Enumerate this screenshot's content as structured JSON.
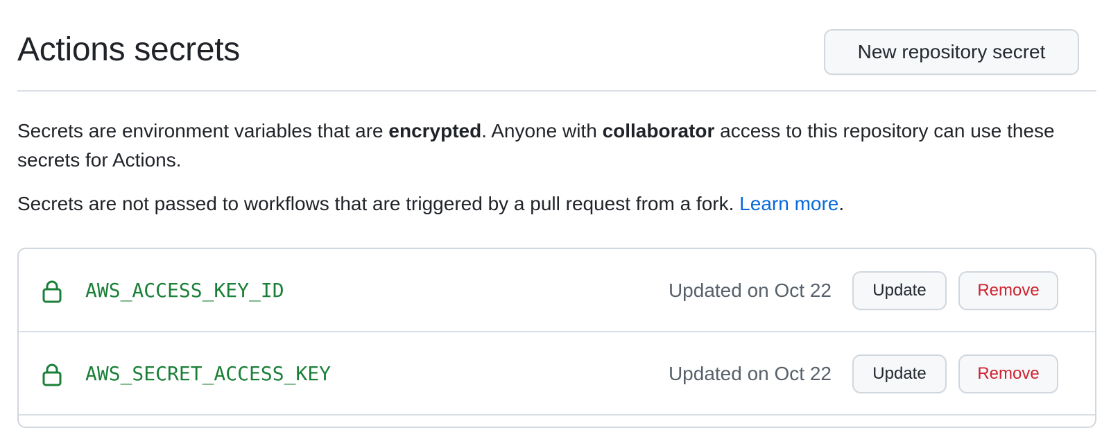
{
  "header": {
    "title": "Actions secrets",
    "new_secret_label": "New repository secret"
  },
  "description": {
    "line1_part1": "Secrets are environment variables that are ",
    "line1_bold1": "encrypted",
    "line1_part2": ". Anyone with ",
    "line1_bold2": "collaborator",
    "line1_part3": " access to this repository can use these secrets for Actions.",
    "line2_text": "Secrets are not passed to workflows that are triggered by a pull request from a fork. ",
    "learn_more": "Learn more",
    "line2_end": "."
  },
  "secrets": [
    {
      "name": "AWS_ACCESS_KEY_ID",
      "updated": "Updated on Oct 22",
      "update_label": "Update",
      "remove_label": "Remove",
      "icon": "lock-icon"
    },
    {
      "name": "AWS_SECRET_ACCESS_KEY",
      "updated": "Updated on Oct 22",
      "update_label": "Update",
      "remove_label": "Remove",
      "icon": "lock-icon"
    }
  ],
  "colors": {
    "secret_name": "#1a7f37",
    "link": "#0969da",
    "remove": "#cf222e",
    "muted": "#57606a"
  }
}
